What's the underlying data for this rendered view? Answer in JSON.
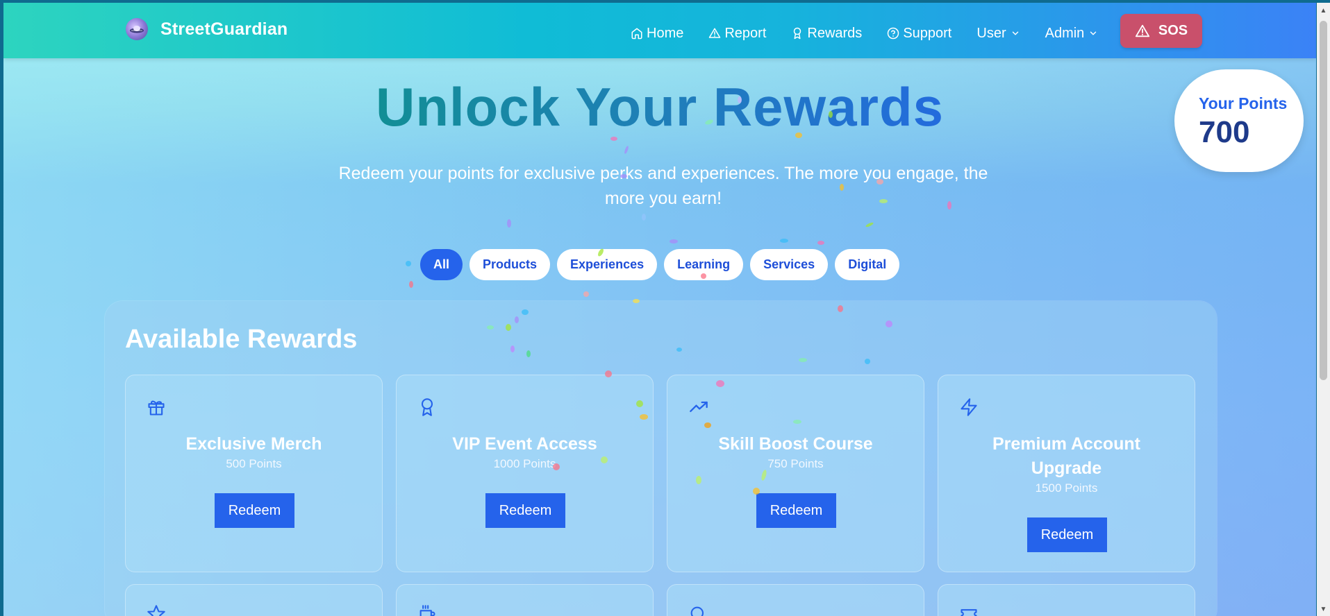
{
  "brand": {
    "name": "StreetGuardian",
    "logo_icon": "ufo-logo-icon"
  },
  "nav": {
    "home": "Home",
    "report": "Report",
    "rewards": "Rewards",
    "support": "Support",
    "user": "User",
    "admin": "Admin",
    "sos": "SOS"
  },
  "hero": {
    "title": "Unlock Your Rewards",
    "subtitle": "Redeem your points for exclusive perks and experiences. The more you engage, the more you earn!"
  },
  "points": {
    "label": "Your Points",
    "value": "700"
  },
  "filters": [
    "All",
    "Products",
    "Experiences",
    "Learning",
    "Services",
    "Digital"
  ],
  "active_filter": "All",
  "rewards": {
    "title": "Available Rewards",
    "redeem_label": "Redeem",
    "items": [
      {
        "name": "Exclusive Merch",
        "points": "500 Points",
        "icon": "gift-icon"
      },
      {
        "name": "VIP Event Access",
        "points": "1000 Points",
        "icon": "award-icon"
      },
      {
        "name": "Skill Boost Course",
        "points": "750 Points",
        "icon": "trending-up-icon"
      },
      {
        "name": "Premium Account Upgrade",
        "points": "1500 Points",
        "icon": "zap-icon"
      }
    ],
    "partial_row_icons": [
      "star-icon",
      "coffee-icon",
      "search-icon",
      "ticket-icon"
    ]
  },
  "colors": {
    "primary": "#2563eb",
    "sos": "#c9506b",
    "title_start": "#0d9488",
    "title_end": "#2563eb"
  }
}
